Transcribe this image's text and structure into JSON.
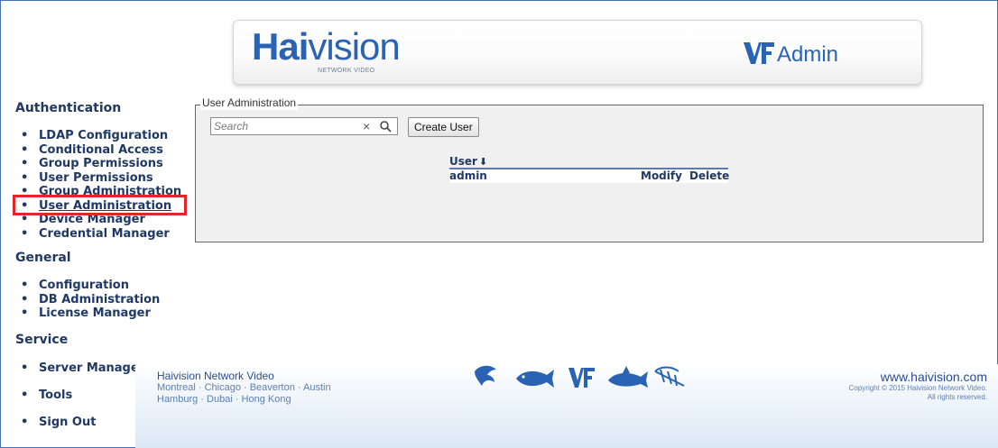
{
  "header": {
    "brand_bold": "Hai",
    "brand_light": "vision",
    "brand_sub": "NETWORK VIDEO",
    "product": "Admin"
  },
  "sidebar": {
    "sections": [
      {
        "title": "Authentication",
        "items": [
          {
            "label": "LDAP Configuration"
          },
          {
            "label": "Conditional Access"
          },
          {
            "label": "Group Permissions"
          },
          {
            "label": "User Permissions"
          },
          {
            "label": "Group Administration"
          },
          {
            "label": "User Administration",
            "active": true
          },
          {
            "label": "Device Manager"
          },
          {
            "label": "Credential Manager"
          }
        ]
      },
      {
        "title": "General",
        "items": [
          {
            "label": "Configuration"
          },
          {
            "label": "DB Administration"
          },
          {
            "label": "License Manager"
          }
        ]
      },
      {
        "title": "Service",
        "items": [
          {
            "label": "Server Manager"
          },
          {
            "label": "Tools"
          },
          {
            "label": "Sign Out"
          }
        ]
      }
    ],
    "bullet": "•"
  },
  "main": {
    "panel_title": "User Administration",
    "search": {
      "placeholder": "Search",
      "value": "",
      "clear_glyph": "×"
    },
    "create_button": "Create User",
    "table": {
      "columns": [
        "User",
        "",
        ""
      ],
      "sort_glyph": "⬇",
      "rows": [
        {
          "user": "admin",
          "modify": "Modify",
          "delete": "Delete"
        }
      ]
    }
  },
  "footer": {
    "company": "Haivision Network Video",
    "cities_line1": "Montreal · Chicago · Beaverton · Austin",
    "cities_line2": "Hamburg · Dubai · Hong Kong",
    "url": "www.haivision.com",
    "copyright": "Copyright © 2015 Haivision Network Video.",
    "rights": "All rights reserved."
  },
  "colors": {
    "brand_blue": "#2a63b3",
    "nav_text": "#1f3864",
    "highlight_red": "#e3262b",
    "panel_bg": "#f0f0f0"
  },
  "icons": [
    "vf-logo-icon",
    "shark-icon",
    "fish-icon",
    "search-icon",
    "clear-icon"
  ]
}
